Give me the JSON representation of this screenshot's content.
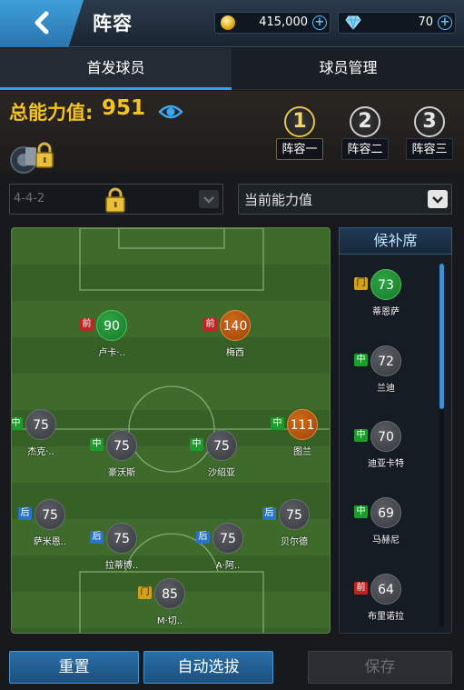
{
  "header": {
    "title": "阵容",
    "gold": "415,000",
    "diamonds": "70"
  },
  "tabs": {
    "starting": "首发球员",
    "manage": "球员管理"
  },
  "power": {
    "label": "总能力值:",
    "value": "951"
  },
  "lineups": [
    {
      "num": "1",
      "label": "阵容一",
      "active": true
    },
    {
      "num": "2",
      "label": "阵容二",
      "active": false
    },
    {
      "num": "3",
      "label": "阵容三",
      "active": false
    }
  ],
  "formation": "4-4-2",
  "sort_by": "当前能力值",
  "starters": [
    {
      "pos": "前",
      "rating": "90",
      "name": "卢卡·.."
    },
    {
      "pos": "前",
      "rating": "140",
      "name": "梅西"
    },
    {
      "pos": "中",
      "rating": "75",
      "name": "杰克·.."
    },
    {
      "pos": "中",
      "rating": "75",
      "name": "豪沃斯"
    },
    {
      "pos": "中",
      "rating": "75",
      "name": "沙绍亚"
    },
    {
      "pos": "中",
      "rating": "111",
      "name": "图兰"
    },
    {
      "pos": "后",
      "rating": "75",
      "name": "萨米恩.."
    },
    {
      "pos": "后",
      "rating": "75",
      "name": "拉蒂博.."
    },
    {
      "pos": "后",
      "rating": "75",
      "name": "A·阿.."
    },
    {
      "pos": "后",
      "rating": "75",
      "name": "贝尔德"
    },
    {
      "pos": "门",
      "rating": "85",
      "name": "M·切.."
    }
  ],
  "bench": {
    "title": "候补席",
    "players": [
      {
        "pos": "门",
        "rating": "73",
        "name": "蒂恩萨"
      },
      {
        "pos": "中",
        "rating": "72",
        "name": "兰迪"
      },
      {
        "pos": "中",
        "rating": "70",
        "name": "迪亚卡特"
      },
      {
        "pos": "中",
        "rating": "69",
        "name": "马赫尼"
      },
      {
        "pos": "前",
        "rating": "64",
        "name": "布里诺拉"
      }
    ]
  },
  "buttons": {
    "reset": "重置",
    "auto": "自动选拔",
    "save": "保存"
  },
  "colors": {
    "accent": "#35a3e6",
    "power_gold": "#f3c324",
    "forward_badge": "#c02424",
    "midfield_badge": "#1d9b2c",
    "defender_badge": "#2a74c8",
    "keeper_badge": "#d2a11a"
  }
}
